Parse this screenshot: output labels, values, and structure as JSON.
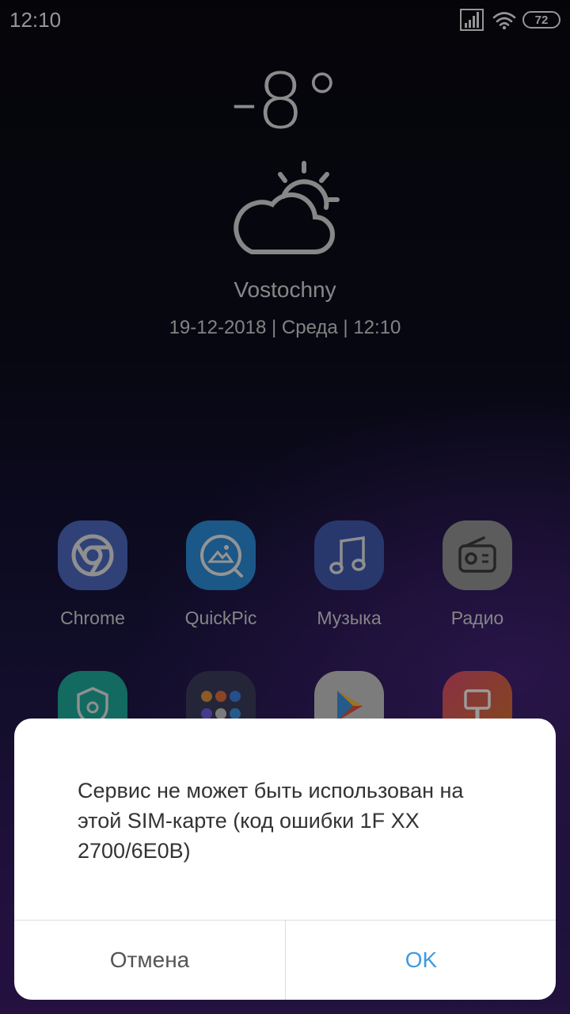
{
  "status_bar": {
    "time": "12:10",
    "battery": "72",
    "icons": [
      "signal-icon",
      "wifi-icon",
      "battery-icon"
    ]
  },
  "weather": {
    "temperature": "-8°",
    "icon": "partly-cloudy-icon",
    "city": "Vostochny",
    "datetime": "19-12-2018 | Среда | 12:10"
  },
  "apps": {
    "row1": [
      {
        "label": "Chrome",
        "icon": "chrome-icon",
        "color": "#4b64b8"
      },
      {
        "label": "QuickPic",
        "icon": "quickpic-icon",
        "color": "#2a86cf"
      },
      {
        "label": "Музыка",
        "icon": "music-icon",
        "color": "#3e56a8"
      },
      {
        "label": "Радио",
        "icon": "radio-icon",
        "color": "#8e8e8e"
      }
    ],
    "row2": [
      {
        "icon": "security-icon",
        "color": "#1ea394"
      },
      {
        "icon": "folder-icon",
        "color": "#3a3a58"
      },
      {
        "icon": "play-store-icon",
        "color": "#bfbfbf"
      },
      {
        "icon": "theme-icon",
        "color": "#c74a5a"
      }
    ]
  },
  "dialog": {
    "message": "Сервис не может быть использован на этой SIM-карте (код ошибки 1F XX 2700/6E0B)",
    "cancel_label": "Отмена",
    "ok_label": "OK",
    "ok_color": "#3d9be0"
  }
}
